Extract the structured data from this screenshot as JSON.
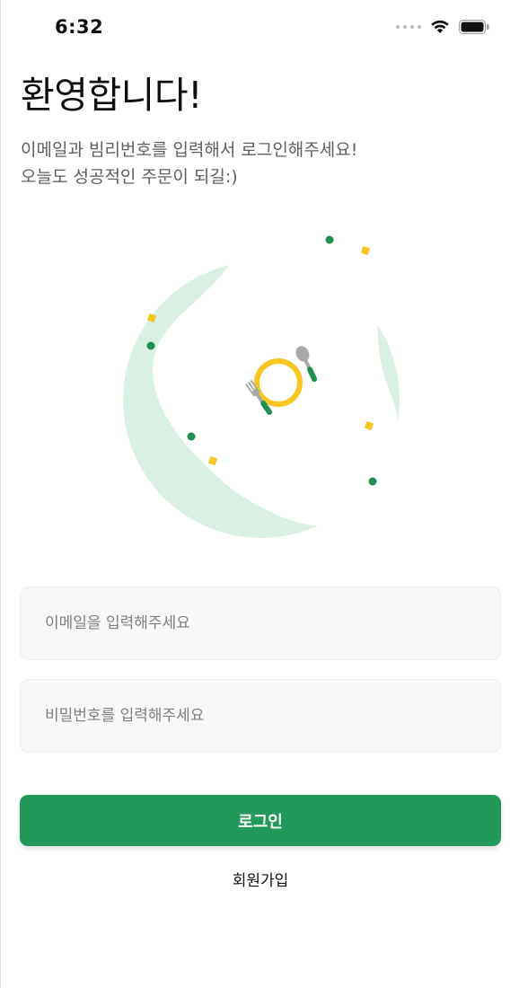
{
  "status_bar": {
    "time": "6:32",
    "icons": [
      "signal-dots-icon",
      "wifi-icon",
      "battery-icon"
    ]
  },
  "header": {
    "title": "환영합니다!",
    "subtitle_lines": [
      "이메일과 빔리번호를 입력해서 로그인해주세요!",
      "오늘도 성공적인 주문이 되길:)"
    ]
  },
  "form": {
    "email_placeholder": "이메일을 입력해주세요",
    "password_placeholder": "비밀번호를 입력해주세요",
    "login_label": "로그인",
    "signup_label": "회원가입"
  },
  "colors": {
    "brand_green": "#22995a",
    "illustration_green": "#d7f0e1",
    "accent_yellow": "#f7c620"
  }
}
